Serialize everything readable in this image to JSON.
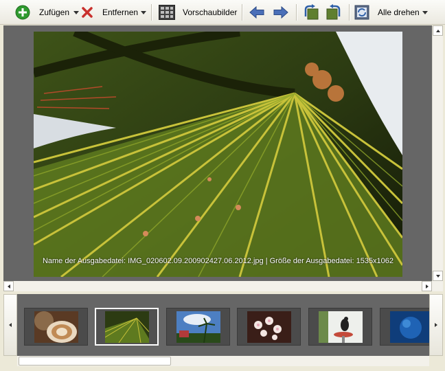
{
  "toolbar": {
    "add_label": "Zufügen",
    "remove_label": "Entfernen",
    "thumbnails_label": "Vorschaubilder",
    "rotate_all_label": "Alle drehen"
  },
  "viewer": {
    "caption": "Name der Ausgabedatei: IMG_020602.09.200902427.06.2012.jpg | Größe der Ausgabedatei: 1535x1062"
  },
  "thumbnails": [
    {
      "subject": "coffee-cup"
    },
    {
      "subject": "palm-leaf",
      "selected": true
    },
    {
      "subject": "palm-trees-sky"
    },
    {
      "subject": "white-flowers"
    },
    {
      "subject": "bird-on-bowl"
    },
    {
      "subject": "blue-underwater"
    }
  ],
  "colors": {
    "add_green": "#2f9a2f",
    "remove_red": "#c9302c",
    "nav_blue": "#4a6fb8",
    "viewer_bg": "#666666"
  }
}
